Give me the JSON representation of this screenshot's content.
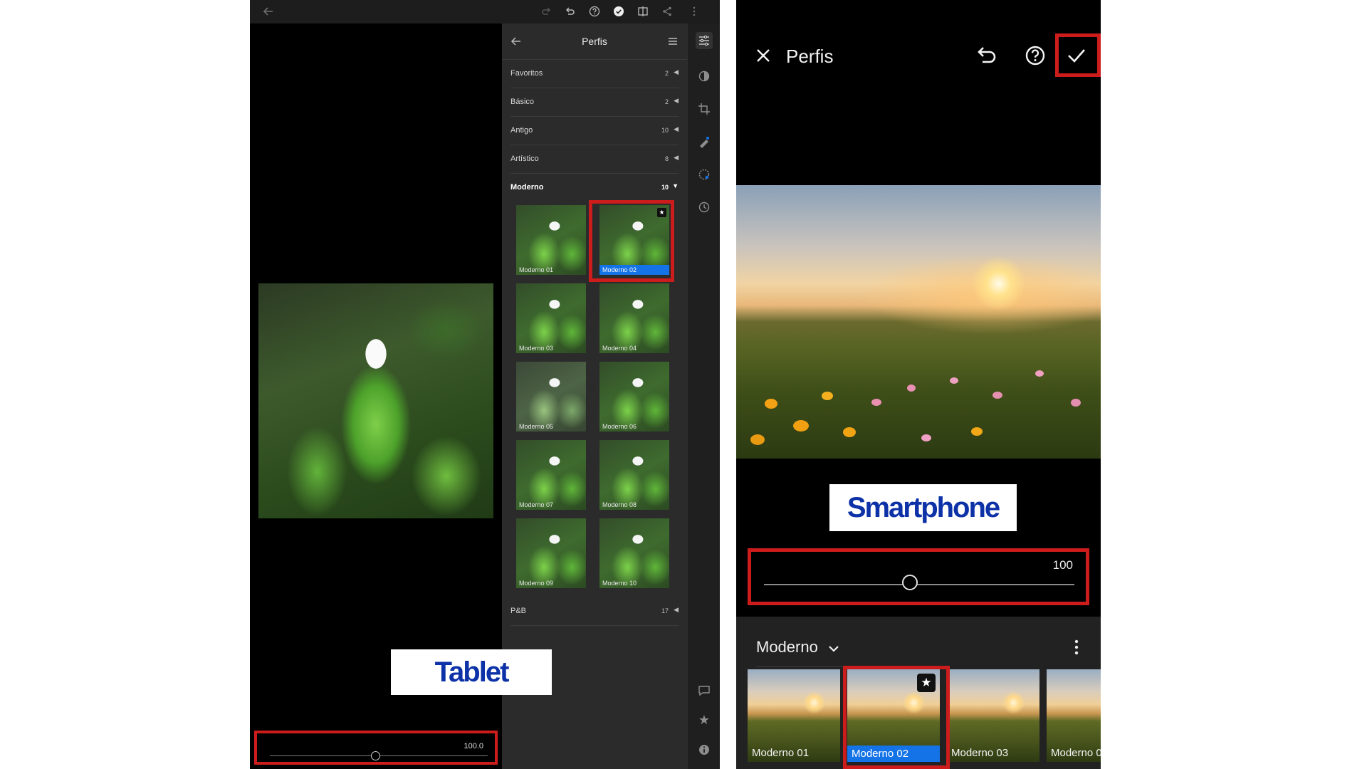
{
  "tablet": {
    "panel_title": "Perfis",
    "categories": [
      {
        "label": "Favoritos",
        "count": "2"
      },
      {
        "label": "Básico",
        "count": "2"
      },
      {
        "label": "Antigo",
        "count": "10"
      },
      {
        "label": "Artístico",
        "count": "8"
      },
      {
        "label": "Moderno",
        "count": "10"
      },
      {
        "label": "P&B",
        "count": "17"
      }
    ],
    "thumbnails": [
      "Moderno 01",
      "Moderno 02",
      "Moderno 03",
      "Moderno 04",
      "Moderno 05",
      "Moderno 06",
      "Moderno 07",
      "Moderno 08",
      "Moderno 09",
      "Moderno 10"
    ],
    "selected_thumbnail": "Moderno 02",
    "slider_value": "100.0",
    "label": "Tablet"
  },
  "phone": {
    "title": "Perfis",
    "slider_value": "100",
    "category": "Moderno",
    "thumbnails": [
      "Moderno 01",
      "Moderno 02",
      "Moderno 03",
      "Moderno 0"
    ],
    "selected_thumbnail": "Moderno 02",
    "label": "Smartphone"
  },
  "colors": {
    "highlight": "#cc1c1c",
    "selection_blue": "#1473e6",
    "label_text": "#0d32a8"
  },
  "icons": [
    "back-arrow-icon",
    "redo-icon",
    "undo-icon",
    "help-icon",
    "check-icon",
    "compare-icon",
    "share-icon",
    "more-icon",
    "menu-icon",
    "edit-sliders-icon",
    "mask-icon",
    "crop-icon",
    "healing-icon",
    "presets-icon",
    "history-icon",
    "comment-icon",
    "star-icon",
    "info-icon",
    "close-icon",
    "chevron-down-icon"
  ]
}
